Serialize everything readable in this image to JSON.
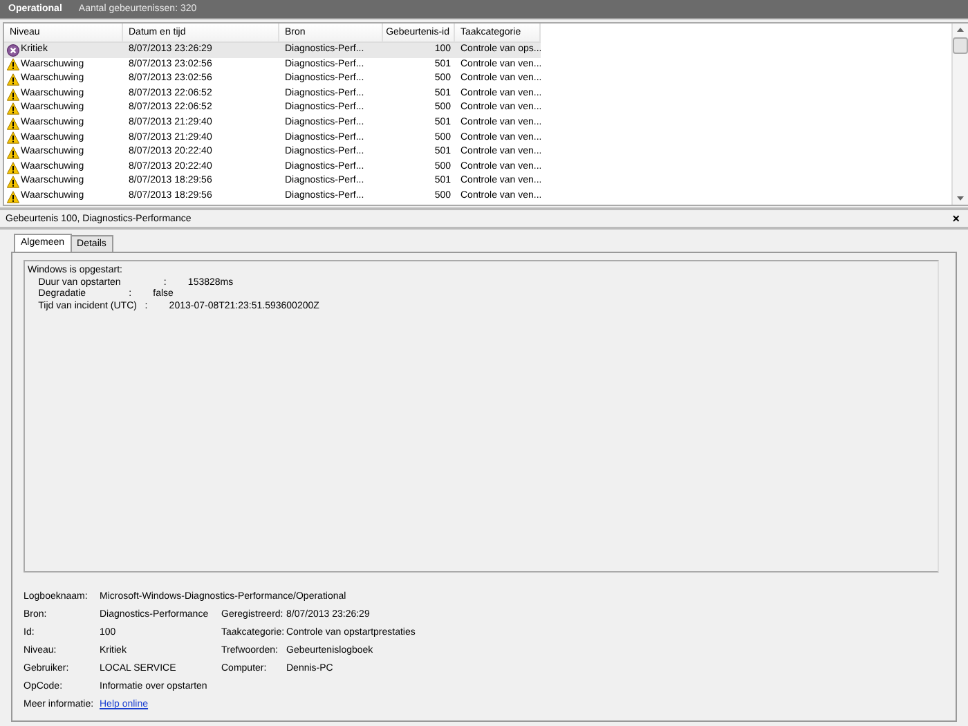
{
  "log_bar": {
    "title": "Operational",
    "count": "Aantal gebeurtenissen: 320"
  },
  "table": {
    "columns": [
      "Niveau",
      "Datum en tijd",
      "Bron",
      "Gebeurtenis-id",
      "Taakcategorie"
    ],
    "rows": [
      {
        "kind": "critical",
        "level": "Kritiek",
        "date": "8/07/2013 23:26:29",
        "source": "Diagnostics-Perf...",
        "id": "100",
        "category": "Controle van ops...",
        "selected": true
      },
      {
        "kind": "warning",
        "level": "Waarschuwing",
        "date": "8/07/2013 23:02:56",
        "source": "Diagnostics-Perf...",
        "id": "501",
        "category": "Controle van ven...",
        "selected": false
      },
      {
        "kind": "warning",
        "level": "Waarschuwing",
        "date": "8/07/2013 23:02:56",
        "source": "Diagnostics-Perf...",
        "id": "500",
        "category": "Controle van ven...",
        "selected": false
      },
      {
        "kind": "warning",
        "level": "Waarschuwing",
        "date": "8/07/2013 22:06:52",
        "source": "Diagnostics-Perf...",
        "id": "501",
        "category": "Controle van ven...",
        "selected": false
      },
      {
        "kind": "warning",
        "level": "Waarschuwing",
        "date": "8/07/2013 22:06:52",
        "source": "Diagnostics-Perf...",
        "id": "500",
        "category": "Controle van ven...",
        "selected": false
      },
      {
        "kind": "warning",
        "level": "Waarschuwing",
        "date": "8/07/2013 21:29:40",
        "source": "Diagnostics-Perf...",
        "id": "501",
        "category": "Controle van ven...",
        "selected": false
      },
      {
        "kind": "warning",
        "level": "Waarschuwing",
        "date": "8/07/2013 21:29:40",
        "source": "Diagnostics-Perf...",
        "id": "500",
        "category": "Controle van ven...",
        "selected": false
      },
      {
        "kind": "warning",
        "level": "Waarschuwing",
        "date": "8/07/2013 20:22:40",
        "source": "Diagnostics-Perf...",
        "id": "501",
        "category": "Controle van ven...",
        "selected": false
      },
      {
        "kind": "warning",
        "level": "Waarschuwing",
        "date": "8/07/2013 20:22:40",
        "source": "Diagnostics-Perf...",
        "id": "500",
        "category": "Controle van ven...",
        "selected": false
      },
      {
        "kind": "warning",
        "level": "Waarschuwing",
        "date": "8/07/2013 18:29:56",
        "source": "Diagnostics-Perf...",
        "id": "501",
        "category": "Controle van ven...",
        "selected": false
      },
      {
        "kind": "warning",
        "level": "Waarschuwing",
        "date": "8/07/2013 18:29:56",
        "source": "Diagnostics-Perf...",
        "id": "500",
        "category": "Controle van ven...",
        "selected": false
      }
    ]
  },
  "detail": {
    "title": "Gebeurtenis 100, Diagnostics-Performance",
    "close": "×",
    "tabs": [
      {
        "label": "Algemeen",
        "selected": true
      },
      {
        "label": "Details",
        "selected": false
      }
    ],
    "message": [
      "Windows is opgestart:",
      "    Duur van opstarten                :        153828ms",
      "    Degradatie                :        false",
      "    Tijd van incident (UTC)   :        2013-07-08T21:23:51.593600200Z"
    ],
    "properties": [
      [
        {
          "label": "Logboeknaam:",
          "value": "Microsoft-Windows-Diagnostics-Performance/Operational",
          "kind": "wide"
        }
      ],
      [
        {
          "label": "Bron:",
          "value": "Diagnostics-Performance",
          "kind": "text"
        },
        {
          "label": "Geregistreerd:",
          "value": "8/07/2013 23:26:29",
          "kind": "text"
        }
      ],
      [
        {
          "label": "Id:",
          "value": "100",
          "kind": "text"
        },
        {
          "label": "Taakcategorie:",
          "value": "Controle van opstartprestaties",
          "kind": "text"
        }
      ],
      [
        {
          "label": "Niveau:",
          "value": "Kritiek",
          "kind": "text"
        },
        {
          "label": "Trefwoorden:",
          "value": "Gebeurtenislogboek",
          "kind": "text"
        }
      ],
      [
        {
          "label": "Gebruiker:",
          "value": "LOCAL SERVICE",
          "kind": "text"
        },
        {
          "label": "Computer:",
          "value": "Dennis-PC",
          "kind": "text"
        }
      ],
      [
        {
          "label": "OpCode:",
          "value": "Informatie over opstarten",
          "kind": "text"
        }
      ],
      [
        {
          "label": "Meer informatie:",
          "value": "Help online",
          "kind": "link"
        }
      ]
    ]
  }
}
